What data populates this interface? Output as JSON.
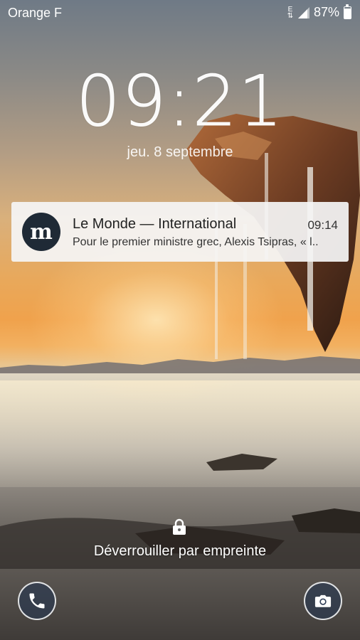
{
  "status_bar": {
    "carrier": "Orange F",
    "network_type": "E",
    "battery_percent": "87%",
    "battery_level": 0.87,
    "icons": [
      "data-network-icon",
      "signal-icon",
      "battery-icon"
    ]
  },
  "lock_screen": {
    "time": "09:21",
    "date": "jeu. 8 septembre"
  },
  "notification": {
    "app_icon_letter": "m",
    "title": "Le Monde — International",
    "time": "09:14",
    "text": "Pour le premier ministre grec, Alexis Tsipras, « l.."
  },
  "unlock": {
    "hint": "Déverrouiller par empreinte",
    "icon": "lock-icon"
  },
  "shortcuts": {
    "left_icon": "phone-icon",
    "right_icon": "camera-icon"
  },
  "colors": {
    "notification_bg": "#f5f5f5",
    "app_icon_bg": "#1f2a36",
    "text_white": "#ffffff"
  }
}
